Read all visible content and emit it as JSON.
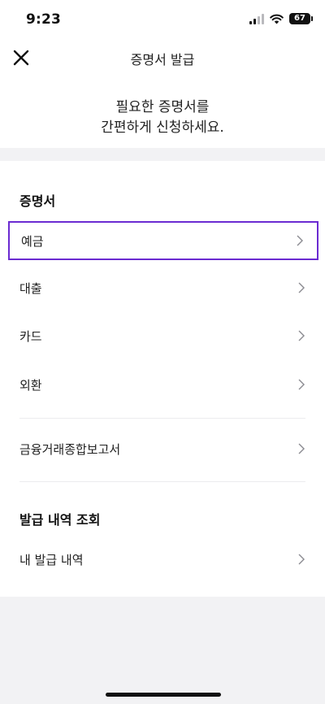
{
  "status_bar": {
    "time": "9:23",
    "battery": "67"
  },
  "header": {
    "title": "증명서 발급"
  },
  "intro": {
    "line1": "필요한 증명서를",
    "line2": "간편하게 신청하세요."
  },
  "certificates": {
    "title": "증명서",
    "items": [
      {
        "label": "예금"
      },
      {
        "label": "대출"
      },
      {
        "label": "카드"
      },
      {
        "label": "외환"
      },
      {
        "label": "금융거래종합보고서"
      }
    ]
  },
  "history": {
    "title": "발급 내역 조회",
    "items": [
      {
        "label": "내 발급 내역"
      }
    ]
  },
  "colors": {
    "selection_border": "#6b2bd1",
    "background": "#f2f2f4"
  },
  "icons": [
    "close-icon",
    "chevron-right-icon",
    "signal-icon",
    "wifi-icon",
    "battery-icon"
  ]
}
